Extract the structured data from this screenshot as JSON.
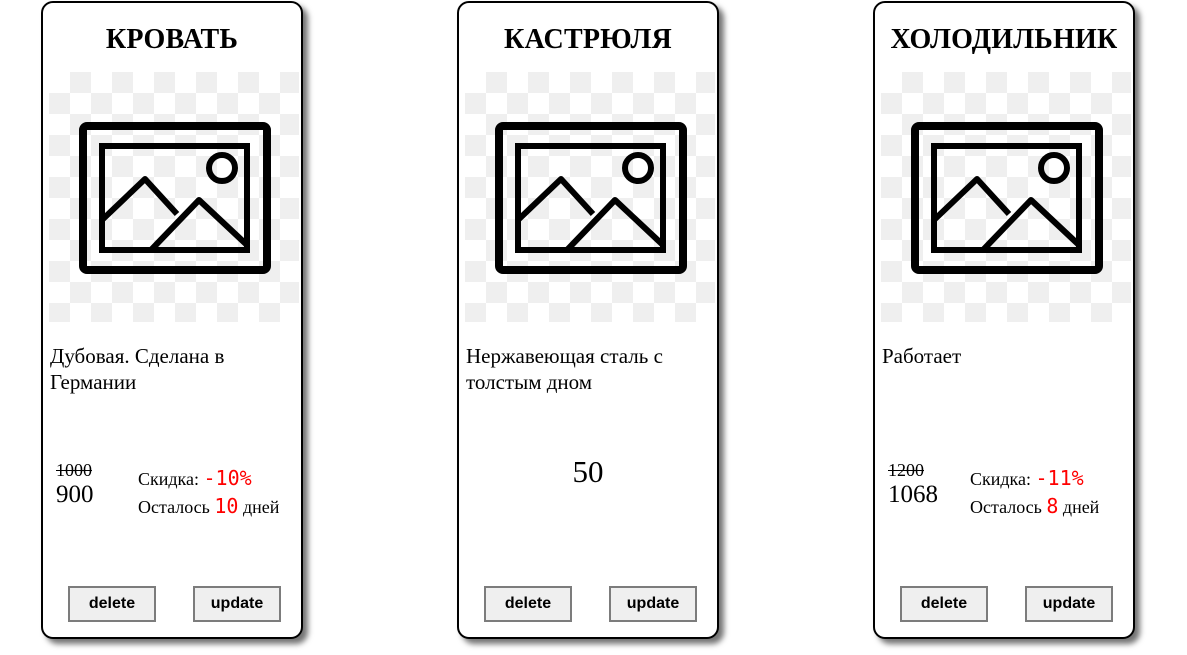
{
  "cards": [
    {
      "title": "КРОВАТЬ",
      "image_icon": "image-placeholder-icon",
      "description": "Дубовая. Сделана в Германии",
      "old_price": "1000",
      "new_price": "900",
      "discount_label": "Скидка: ",
      "discount_value": "-10%",
      "remaining_label": "Осталось ",
      "remaining_value": "10",
      "remaining_suffix": " дней",
      "delete_label": "delete",
      "update_label": "update"
    },
    {
      "title": "КАСТРЮЛЯ",
      "image_icon": "image-placeholder-icon",
      "description": "Нержавеющая сталь с толстым дном",
      "price": "50",
      "delete_label": "delete",
      "update_label": "update"
    },
    {
      "title": "ХОЛОДИЛЬНИК",
      "image_icon": "image-placeholder-icon",
      "description": "Работает",
      "old_price": "1200",
      "new_price": "1068",
      "discount_label": "Скидка: ",
      "discount_value": "-11%",
      "remaining_label": "Осталось ",
      "remaining_value": "8",
      "remaining_suffix": " дней",
      "delete_label": "delete",
      "update_label": "update"
    }
  ],
  "colors": {
    "discount_red": "#ff0000",
    "card_border": "#000000",
    "button_bg": "#efefef"
  }
}
